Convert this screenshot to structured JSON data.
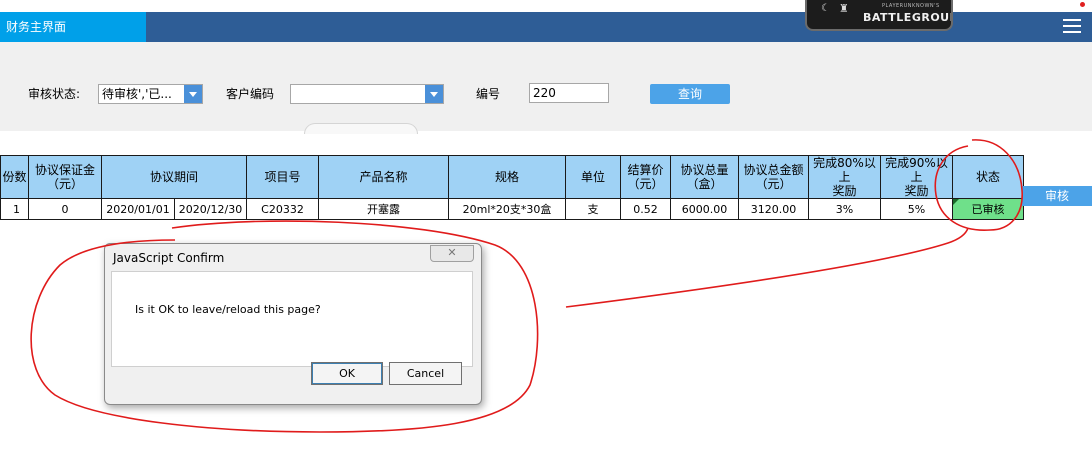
{
  "header": {
    "tab_label": "财务主界面",
    "logo_small": "PLAYERUNKNOWN'S",
    "logo_big": "BATTLEGROUNDS",
    "accent_color": "#00a0e9",
    "bar_color": "#2e5d96"
  },
  "filters": {
    "status_label": "审核状态:",
    "status_value": "待审核','已...",
    "customer_label": "客户编码",
    "customer_value": "",
    "number_label": "编号",
    "number_value": "220",
    "query_button": "查询"
  },
  "table": {
    "columns": [
      "份数",
      "协议保证金（元）",
      "协议期间",
      "项目号",
      "产品名称",
      "规格",
      "单位",
      "结算价（元）",
      "协议总量（盒）",
      "协议总金额（元）",
      "完成80%以上奖励",
      "完成90%以上奖励",
      "状态"
    ],
    "header_lines": {
      "c0": "份数",
      "c1a": "协议保证金",
      "c1b": "（元）",
      "c2": "协议期间",
      "c3": "项目号",
      "c4": "产品名称",
      "c5": "规格",
      "c6": "单位",
      "c7a": "结算价",
      "c7b": "（元）",
      "c8a": "协议总量",
      "c8b": "（盒）",
      "c9a": "协议总金额",
      "c9b": "（元）",
      "c10a": "完成80%以上",
      "c10b": "奖励",
      "c11a": "完成90%以上",
      "c11b": "奖励",
      "c12": "状态"
    },
    "rows": [
      {
        "copies": "1",
        "deposit": "0",
        "start": "2020/01/01",
        "end": "2020/12/30",
        "project": "C20332",
        "product": "开塞露",
        "spec": "20ml*20支*30盒",
        "unit": "支",
        "price": "0.52",
        "quantity": "6000.00",
        "amount": "3120.00",
        "reward80": "3%",
        "reward90": "5%",
        "status": "已审核",
        "action": "审核"
      }
    ]
  },
  "dialog": {
    "title": "JavaScript Confirm",
    "message": "Is it OK to leave/reload this page?",
    "ok": "OK",
    "cancel": "Cancel"
  },
  "icons": [
    "menu-icon",
    "close-icon",
    "dropdown-arrow-icon"
  ]
}
